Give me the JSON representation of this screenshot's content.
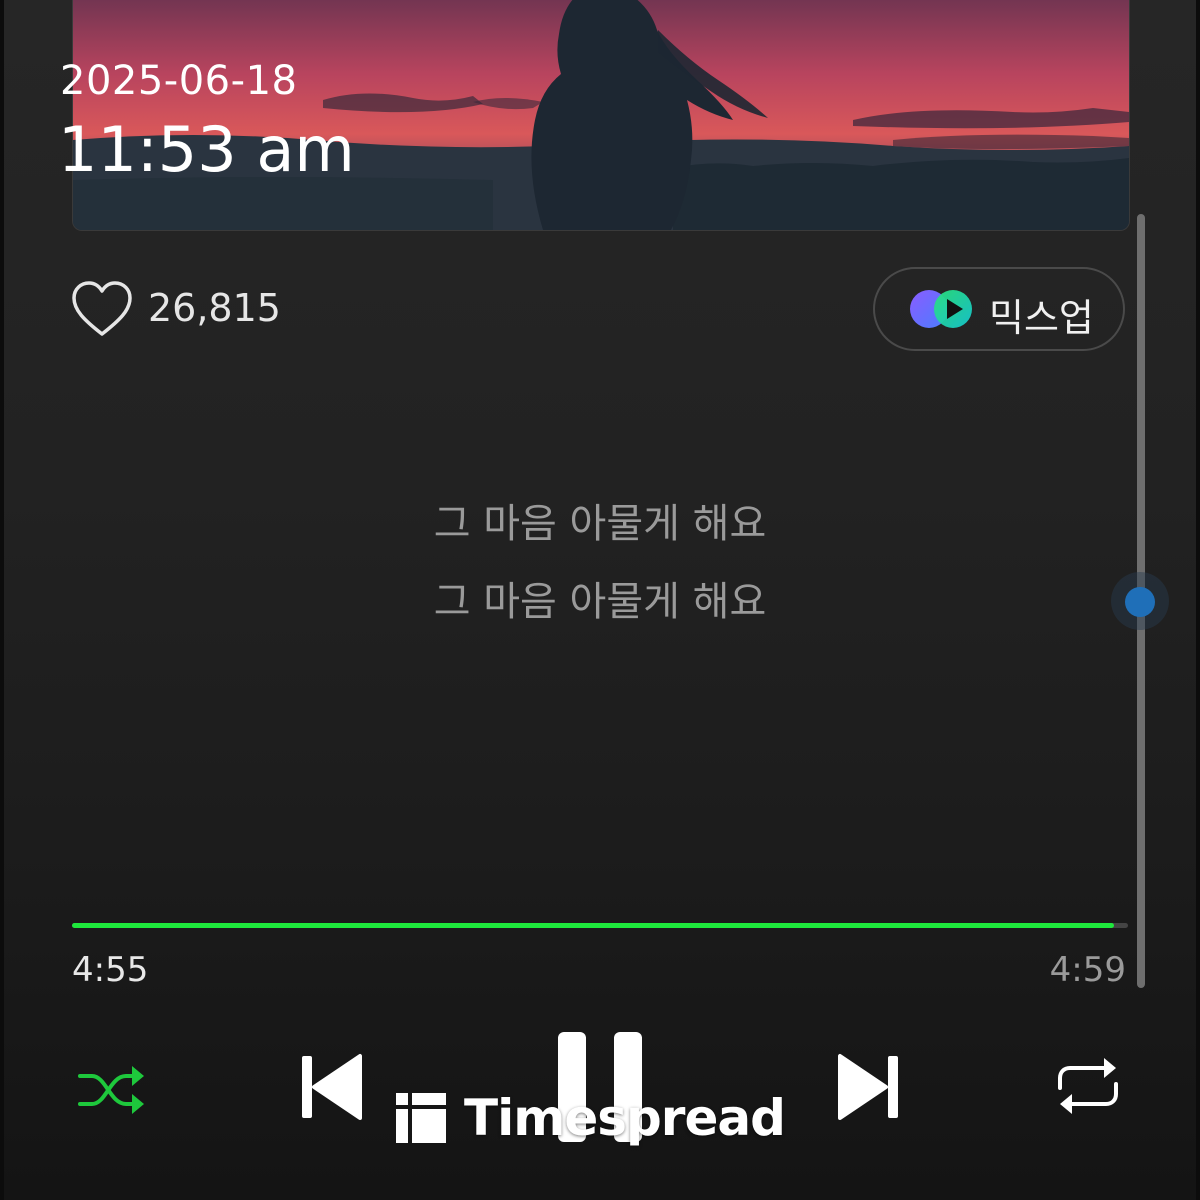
{
  "overlay": {
    "date": "2025-06-18",
    "time": "11:53 am"
  },
  "album_art": {
    "description_icon": "album-cover-image",
    "sky_colors": [
      "#2c2440",
      "#8a3a5a",
      "#d4505a",
      "#e86a52"
    ]
  },
  "like": {
    "icon": "heart-icon",
    "count": "26,815"
  },
  "mixup": {
    "icon": "mixup-play-icon",
    "label": "믹스업"
  },
  "lyrics": [
    "그 마음 아물게 해요",
    "그 마음 아물게 해요"
  ],
  "scrollbar": {
    "position": 0.49
  },
  "playback": {
    "elapsed": "4:55",
    "total": "4:59",
    "progress": 0.9866,
    "accent_color": "#1ee83c"
  },
  "controls": {
    "shuffle": "shuffle-icon",
    "previous": "skip-previous-icon",
    "pause": "pause-icon",
    "next": "skip-next-icon",
    "repeat": "repeat-icon",
    "shuffle_color": "#1ec83c"
  },
  "watermark": {
    "text": "Timespread"
  }
}
